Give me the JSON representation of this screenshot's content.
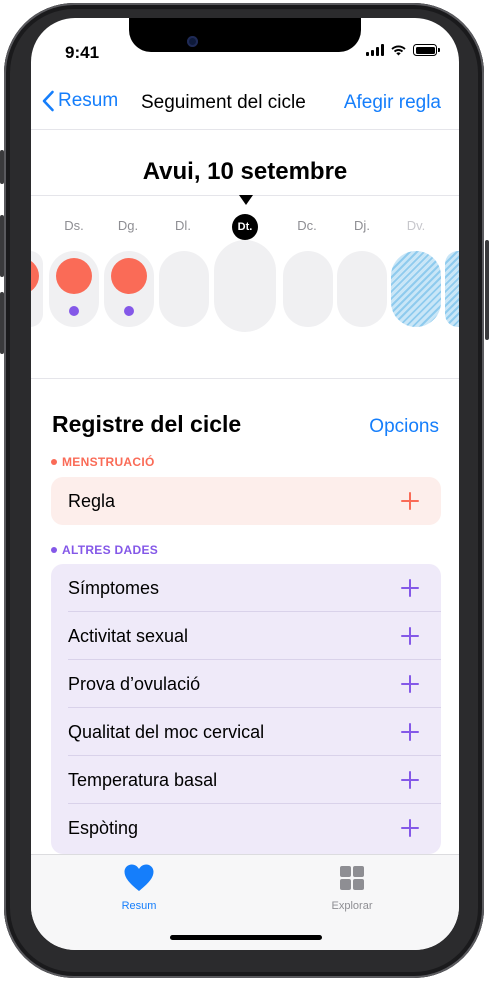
{
  "status": {
    "time": "9:41"
  },
  "nav": {
    "back_label": "Resum",
    "title": "Seguiment del cicle",
    "action_label": "Afegir regla"
  },
  "header": {
    "date_title": "Avui, 10 setembre"
  },
  "days": [
    {
      "label": "Ds."
    },
    {
      "label": "Dg."
    },
    {
      "label": "Dl."
    },
    {
      "label": "Dt."
    },
    {
      "label": "Dc."
    },
    {
      "label": "Dj."
    },
    {
      "label": "Dv."
    }
  ],
  "cycle_log": {
    "title": "Registre del cicle",
    "options_label": "Opcions",
    "period_category": "MENSTRUACIÓ",
    "period_items": [
      "Regla"
    ],
    "other_category": "ALTRES DADES",
    "other_items": [
      "Símptomes",
      "Activitat sexual",
      "Prova d’ovulació",
      "Qualitat del moc cervical",
      "Temperatura basal",
      "Espòting"
    ]
  },
  "tabs": [
    {
      "label": "Resum",
      "icon": "heart-icon",
      "active": true
    },
    {
      "label": "Explorar",
      "icon": "grid-icon",
      "active": false
    }
  ],
  "colors": {
    "accent": "#157efb",
    "period": "#fa6b57",
    "other": "#8458e8",
    "period_card": "#fdeeeb",
    "other_card": "#efeaf9"
  }
}
